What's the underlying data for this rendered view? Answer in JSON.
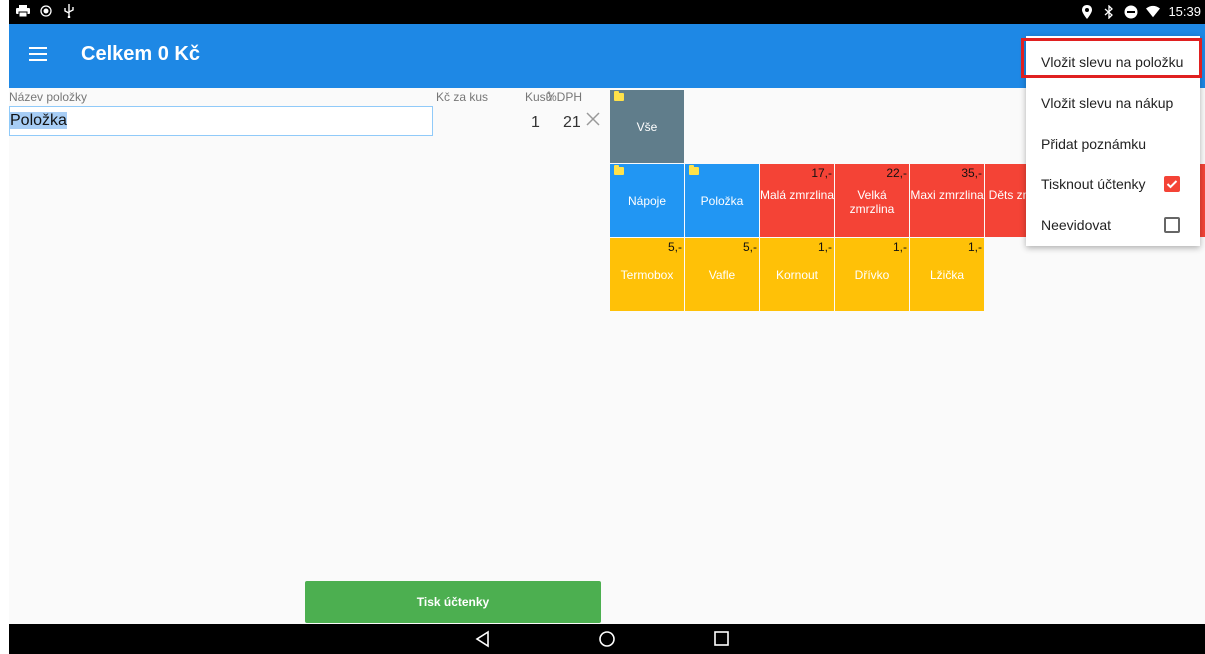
{
  "status_bar": {
    "left_icons": [
      "printer-icon",
      "record-icon",
      "usb-icon"
    ],
    "right_icons": [
      "location-icon",
      "bluetooth-icon",
      "do-not-disturb-icon",
      "wifi-icon"
    ],
    "time": "15:39"
  },
  "app_bar": {
    "title": "Celkem 0 Kč",
    "menu_icon": "hamburger-icon"
  },
  "item_form": {
    "name_label": "Název položky",
    "price_label": "Kč za kus",
    "qty_label": "Kusů",
    "vat_label": "%DPH",
    "name_value": "Položka",
    "qty_value": "1",
    "vat_value": "21",
    "clear_icon": "close-icon"
  },
  "tiles": [
    {
      "id": "vse",
      "label": "Vše",
      "price": "",
      "color": "#607d8b",
      "folder": true
    },
    {
      "id": "napoje",
      "label": "Nápoje",
      "price": "",
      "color": "#2196f3",
      "folder": true
    },
    {
      "id": "polozka",
      "label": "Položka",
      "price": "",
      "color": "#2196f3",
      "folder": true
    },
    {
      "id": "mala",
      "label": "Malá zmrzlina",
      "price": "17,-",
      "color": "#f44336",
      "folder": false
    },
    {
      "id": "velka",
      "label": "Velká zmrzlina",
      "price": "22,-",
      "color": "#f44336",
      "folder": false
    },
    {
      "id": "maxi",
      "label": "Maxi zmrzlina",
      "price": "35,-",
      "color": "#f44336",
      "folder": false
    },
    {
      "id": "detska",
      "label": "Děts zmrzl",
      "price": "",
      "color": "#f44336",
      "folder": false
    },
    {
      "id": "termobox",
      "label": "Termobox",
      "price": "5,-",
      "color": "#ffc107",
      "folder": false
    },
    {
      "id": "vafle",
      "label": "Vafle",
      "price": "5,-",
      "color": "#ffc107",
      "folder": false
    },
    {
      "id": "kornout",
      "label": "Kornout",
      "price": "1,-",
      "color": "#ffc107",
      "folder": false
    },
    {
      "id": "drivko",
      "label": "Dřívko",
      "price": "1,-",
      "color": "#ffc107",
      "folder": false
    },
    {
      "id": "lzicka",
      "label": "Lžička",
      "price": "1,-",
      "color": "#ffc107",
      "folder": false
    }
  ],
  "overflow_menu": {
    "items": [
      {
        "label": "Vložit slevu na položku"
      },
      {
        "label": "Vložit slevu na nákup"
      },
      {
        "label": "Přidat poznámku"
      },
      {
        "label": "Tisknout účtenky",
        "checkbox": true,
        "checked": true
      },
      {
        "label": "Neevidovat",
        "checkbox": true,
        "checked": false
      }
    ],
    "highlighted_index": 0,
    "highlight_color": "#e02020"
  },
  "print_button": {
    "label": "Tisk účtenky",
    "color": "#4caf50"
  },
  "nav_bar": {
    "icons": [
      "back-icon",
      "home-icon",
      "recents-icon"
    ]
  },
  "colors": {
    "app_bar": "#1e88e5",
    "checkbox_checked": "#f44336"
  }
}
